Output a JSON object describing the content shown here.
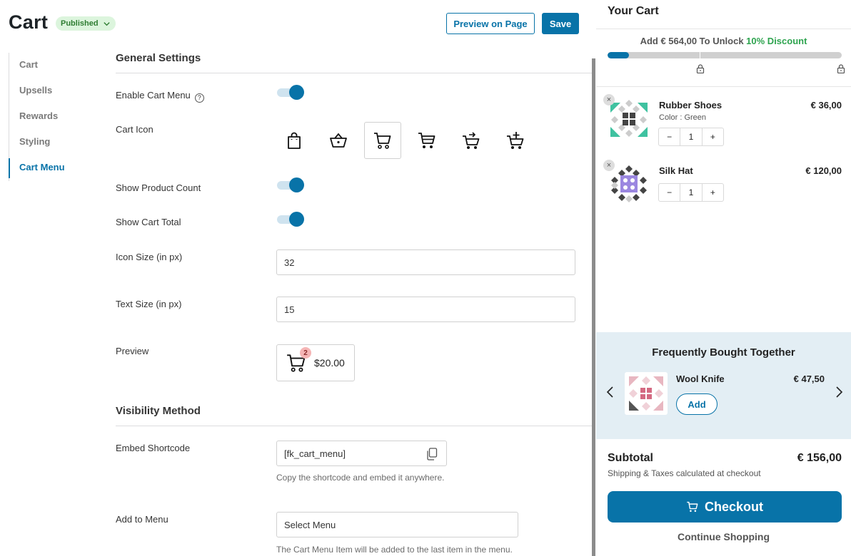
{
  "header": {
    "title": "Cart",
    "status": "Published",
    "preview_label": "Preview on Page",
    "save_label": "Save"
  },
  "sidebar": {
    "items": [
      {
        "label": "Cart",
        "active": false
      },
      {
        "label": "Upsells",
        "active": false
      },
      {
        "label": "Rewards",
        "active": false
      },
      {
        "label": "Styling",
        "active": false
      },
      {
        "label": "Cart Menu",
        "active": true
      }
    ]
  },
  "general": {
    "title": "General Settings",
    "enable_menu_label": "Enable Cart Menu",
    "enable_menu_on": true,
    "help_glyph": "?",
    "cart_icon_label": "Cart Icon",
    "cart_icons": [
      "bag-icon",
      "basket-icon",
      "cart-icon",
      "cart-full-icon",
      "cart-arrow-icon",
      "cart-plus-icon"
    ],
    "selected_icon": "cart-icon",
    "show_count_label": "Show Product Count",
    "show_count_on": true,
    "show_total_label": "Show Cart Total",
    "show_total_on": true,
    "icon_size_label": "Icon Size (in px)",
    "icon_size_value": "32",
    "text_size_label": "Text Size (in px)",
    "text_size_value": "15",
    "preview_label": "Preview",
    "preview_count": "2",
    "preview_total": "$20.00"
  },
  "visibility": {
    "title": "Visibility Method",
    "shortcode_label": "Embed Shortcode",
    "shortcode_value": "[fk_cart_menu]",
    "shortcode_hint": "Copy the shortcode and embed it anywhere.",
    "menu_label": "Add to Menu",
    "menu_value": "Select Menu",
    "menu_hint": "The Cart Menu Item will be added to the last item in the menu."
  },
  "cart": {
    "title": "Your Cart",
    "unlock_prefix": "Add € 564,00 To Unlock ",
    "unlock_highlight": "10% Discount",
    "progress": 0.09,
    "items": [
      {
        "name": "Rubber Shoes",
        "meta": "Color : Green",
        "price": "€ 36,00",
        "qty": "1",
        "minus": "−",
        "plus": "+",
        "remove": "×"
      },
      {
        "name": "Silk Hat",
        "meta": "",
        "price": "€ 120,00",
        "qty": "1",
        "minus": "−",
        "plus": "+",
        "remove": "×"
      }
    ],
    "fbt": {
      "title": "Frequently Bought Together",
      "name": "Wool Knife",
      "price": "€ 47,50",
      "add_label": "Add"
    },
    "subtotal_label": "Subtotal",
    "subtotal_value": "€ 156,00",
    "subtotal_note": "Shipping & Taxes calculated at checkout",
    "checkout_label": "Checkout",
    "continue_label": "Continue Shopping"
  },
  "colors": {
    "accent": "#0873a8",
    "published_bg": "#dcf5dd",
    "published_text": "#2e7d32",
    "discount_text": "#2ea44f",
    "fbt_bg": "#e3eef4"
  }
}
